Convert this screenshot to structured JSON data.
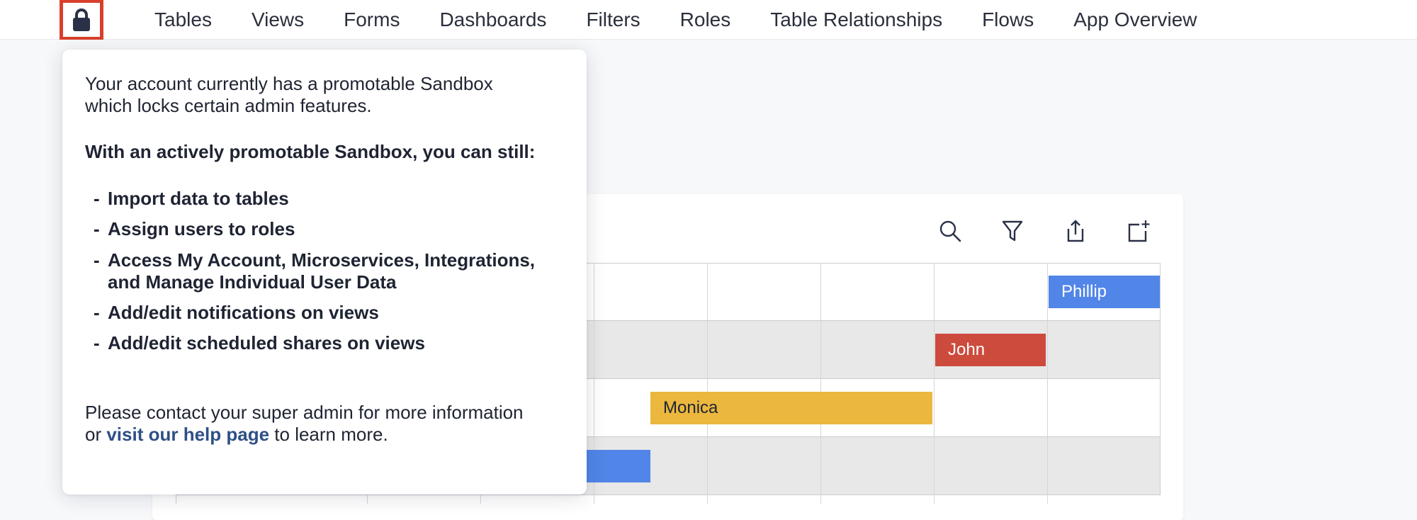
{
  "nav": {
    "items": [
      "Tables",
      "Views",
      "Forms",
      "Dashboards",
      "Filters",
      "Roles",
      "Table Relationships",
      "Flows",
      "App Overview"
    ]
  },
  "colors": {
    "lock_accent": "#d93f2b",
    "event_blue": "#5185e8",
    "event_red": "#cc4b3d",
    "event_yellow": "#ebb73e",
    "link": "#2f4f86"
  },
  "toolbar": {
    "icons": [
      "search-icon",
      "filter-icon",
      "share-icon",
      "add-view-icon"
    ]
  },
  "calendar": {
    "events": [
      {
        "name": "Phillip",
        "color": "blue"
      },
      {
        "name": "John",
        "color": "red"
      },
      {
        "name": "Monica",
        "color": "yellow"
      },
      {
        "name": "",
        "color": "blue"
      }
    ]
  },
  "popover": {
    "intro_line1": "Your account currently has a promotable Sandbox",
    "intro_line2": "which locks certain admin features.",
    "heading": "With an actively promotable Sandbox, you can still:",
    "bullets": [
      "Import data to tables",
      "Assign users to roles",
      "Access My Account, Microservices, Integrations,",
      "Add/edit notifications on views",
      "Add/edit scheduled shares on views"
    ],
    "bullet3_line2": "and Manage Individual User Data",
    "footer_line1": "Please contact your super admin for more information",
    "footer_or": "or ",
    "footer_link": "visit our help page",
    "footer_end": " to learn more."
  }
}
